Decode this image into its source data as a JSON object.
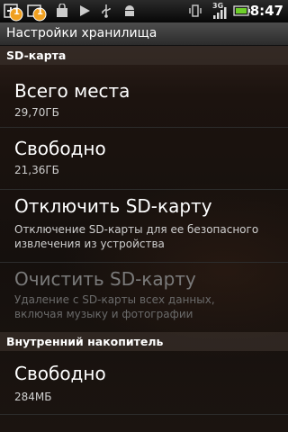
{
  "status_bar": {
    "time": "8:47",
    "icons": [
      "add-notification-icon",
      "notification-badge-icon",
      "shopping-bag-icon",
      "play-icon",
      "usb-icon",
      "android-icon",
      "vibrate-icon",
      "3g-signal-icon",
      "battery-icon"
    ],
    "badge_1": "1",
    "badge_2": "1",
    "network_type": "3G"
  },
  "title": "Настройки хранилища",
  "sd_section": {
    "header": "SD-карта",
    "total": {
      "title": "Всего места",
      "value": "29,70ГБ"
    },
    "free": {
      "title": "Свободно",
      "value": "21,36ГБ"
    },
    "unmount": {
      "title": "Отключить SD-карту",
      "summary_line1": "Отключение SD-карты для ее безопасного",
      "summary_line2": "извлечения из устройства"
    },
    "erase": {
      "title": "Очистить SD-карту",
      "summary_line1": "Удаление с SD-карты всех данных,",
      "summary_line2": "включая музыку и фотографии"
    }
  },
  "internal_section": {
    "header": "Внутренний накопитель",
    "free": {
      "title": "Свободно",
      "value": "284МБ"
    }
  },
  "colors": {
    "accent_battery": "#6ecf2a",
    "badge_orange": "#f0a020"
  }
}
